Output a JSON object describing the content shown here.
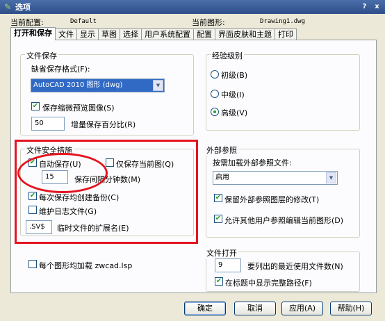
{
  "window": {
    "title": "选项",
    "help_glyph": "?",
    "close_glyph": "x",
    "icon_glyph": "✎"
  },
  "header": {
    "config_label": "当前配置:",
    "config_value": "Default",
    "drawing_label": "当前图形:",
    "drawing_value": "Drawing1.dwg"
  },
  "tabs": [
    {
      "label": "打开和保存",
      "active": true
    },
    {
      "label": "文件"
    },
    {
      "label": "显示"
    },
    {
      "label": "草图"
    },
    {
      "label": "选择"
    },
    {
      "label": "用户系统配置"
    },
    {
      "label": "配置"
    },
    {
      "label": "界面皮肤和主题"
    },
    {
      "label": "打印"
    }
  ],
  "file_save": {
    "title": "文件保存",
    "format_label": "缺省保存格式(F):",
    "format_value": "AutoCAD 2010 图形 (dwg)",
    "thumbnail_label": "保存缩微预览图像(S)",
    "thumbnail_checked": true,
    "increment_value": "50",
    "increment_label": "增量保存百分比(R)"
  },
  "experience": {
    "title": "经验级别",
    "options": [
      {
        "label": "初级(B)",
        "selected": false
      },
      {
        "label": "中级(I)",
        "selected": false
      },
      {
        "label": "高级(V)",
        "selected": true
      }
    ]
  },
  "file_safety": {
    "title": "文件安全措施",
    "autosave_label": "自动保存(U)",
    "autosave_checked": true,
    "save_current_only_label": "仅保存当前图(Q)",
    "save_current_only_checked": false,
    "interval_value": "15",
    "interval_label": "保存间隔分钟数(M)",
    "backup_label": "每次保存均创建备份(C)",
    "backup_checked": true,
    "log_label": "维护日志文件(G)",
    "log_checked": false,
    "ext_value": ".SV$",
    "ext_label": "临时文件的扩展名(E)"
  },
  "xref": {
    "title": "外部参照",
    "load_label": "按需加载外部参照文件:",
    "load_value": "启用",
    "retain_label": "保留外部参照图层的修改(T)",
    "retain_checked": true,
    "allow_label": "允许其他用户参照编辑当前图形(D)",
    "allow_checked": true
  },
  "load_lsp": {
    "label": "每个图形均加载 zwcad.lsp",
    "checked": false
  },
  "file_open": {
    "title": "文件打开",
    "recent_value": "9",
    "recent_label": "要列出的最近使用文件数(N)",
    "fullpath_label": "在标题中显示完整路径(F)",
    "fullpath_checked": true
  },
  "buttons": {
    "ok": "确定",
    "cancel": "取消",
    "apply": "应用(A)",
    "help": "帮助(H)"
  },
  "colors": {
    "annotation_red": "#e4141f",
    "title_bar": "#2e4f8a",
    "check_green": "#21a121"
  }
}
